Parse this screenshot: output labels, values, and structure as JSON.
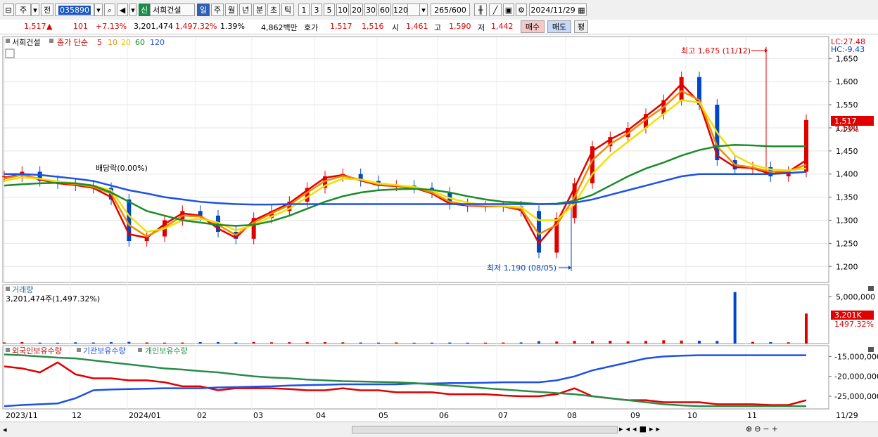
{
  "toolbar": {
    "market": "주",
    "prev": "전",
    "code": "035890",
    "name_tag": "신",
    "name": "서희건설",
    "periods": [
      "일",
      "주",
      "월",
      "년",
      "분",
      "초",
      "틱"
    ],
    "numbers": [
      "1",
      "3",
      "5",
      "10",
      "20",
      "30",
      "60",
      "120"
    ],
    "count": "265",
    "count_total": "/600",
    "date": "2024/11/29"
  },
  "quote": {
    "price": "1,517",
    "arrow": "▲",
    "change": "101",
    "change_pct": "+7.13%",
    "volume": "3,201,474",
    "volume_pct": "1,497.32%",
    "turnover": "1.39%",
    "amount": "4,862백만",
    "hoga_label": "호가",
    "ask": "1,517",
    "bid": "1,516",
    "open_label": "시",
    "open": "1,461",
    "high_label": "고",
    "high": "1,590",
    "low_label": "저",
    "low": "1,442",
    "buy": "매수",
    "sell": "매도",
    "eval": "평"
  },
  "legend": {
    "stock": "서희건설",
    "close_label": "종가 단순",
    "ma": [
      "5",
      "10",
      "20",
      "60",
      "120"
    ],
    "lc": "LC:27.48",
    "hc": "HC:-9.43",
    "dividend": "배당락(0.00%)",
    "high_note": "최고 1,675 (11/12)",
    "low_note": "최저 1,190 (08/05)",
    "last_price": "1,517",
    "last_pct": "7.13%"
  },
  "volume_panel": {
    "title": "거래량",
    "subtitle": "3,201,474주(1,497.32%)",
    "last_box": "3,201K",
    "last_pct": "1497.32%"
  },
  "holdings_panel": {
    "labels": [
      "외국인보유수량",
      "기관보유수량",
      "개인보유수량"
    ]
  },
  "colors": {
    "up": "#e00000",
    "down": "#0046c8",
    "ma5": "#e00000",
    "ma10": "#f08c00",
    "ma20": "#f0e000",
    "ma60": "#1a8c2a",
    "ma120": "#1e50e6",
    "foreign": "#e00000",
    "institution": "#1e50e6",
    "individual": "#2a8c4a"
  },
  "chart_data": [
    {
      "type": "line",
      "title": "서희건설",
      "x": [
        "2023/11",
        "12",
        "2024/01",
        "02",
        "03",
        "04",
        "05",
        "06",
        "07",
        "08",
        "09",
        "10",
        "11",
        "11/29"
      ],
      "ylim": [
        1170,
        1690
      ],
      "yticks": [
        1200,
        1250,
        1300,
        1350,
        1400,
        1450,
        1500,
        1550,
        1600,
        1650
      ],
      "series": [
        {
          "name": "종가",
          "values": [
            1395,
            1405,
            1385,
            1380,
            1375,
            1370,
            1345,
            1255,
            1265,
            1300,
            1320,
            1310,
            1275,
            1260,
            1305,
            1320,
            1340,
            1370,
            1395,
            1400,
            1385,
            1375,
            1375,
            1370,
            1360,
            1335,
            1330,
            1330,
            1330,
            1320,
            1230,
            1305,
            1380,
            1460,
            1480,
            1500,
            1530,
            1560,
            1610,
            1550,
            1430,
            1410,
            1415,
            1395,
            1405,
            1517
          ]
        },
        {
          "name": "5",
          "values": [
            1392,
            1400,
            1388,
            1380,
            1376,
            1370,
            1350,
            1270,
            1262,
            1292,
            1315,
            1310,
            1282,
            1262,
            1300,
            1318,
            1337,
            1365,
            1392,
            1398,
            1386,
            1376,
            1374,
            1370,
            1358,
            1336,
            1332,
            1330,
            1330,
            1322,
            1250,
            1295,
            1370,
            1450,
            1475,
            1495,
            1525,
            1555,
            1595,
            1555,
            1440,
            1415,
            1413,
            1400,
            1405,
            1430
          ]
        },
        {
          "name": "10",
          "values": [
            1390,
            1398,
            1390,
            1382,
            1378,
            1372,
            1358,
            1290,
            1265,
            1285,
            1310,
            1308,
            1290,
            1268,
            1295,
            1315,
            1333,
            1360,
            1385,
            1396,
            1388,
            1378,
            1375,
            1371,
            1360,
            1340,
            1333,
            1331,
            1330,
            1325,
            1270,
            1290,
            1350,
            1430,
            1465,
            1488,
            1518,
            1545,
            1580,
            1560,
            1460,
            1420,
            1414,
            1405,
            1406,
            1420
          ]
        },
        {
          "name": "20",
          "values": [
            1385,
            1393,
            1390,
            1384,
            1380,
            1375,
            1365,
            1310,
            1275,
            1282,
            1300,
            1303,
            1295,
            1278,
            1290,
            1308,
            1325,
            1350,
            1375,
            1390,
            1388,
            1380,
            1376,
            1372,
            1364,
            1348,
            1338,
            1333,
            1331,
            1328,
            1300,
            1300,
            1335,
            1400,
            1440,
            1470,
            1500,
            1530,
            1560,
            1555,
            1490,
            1440,
            1420,
            1410,
            1408,
            1412
          ]
        },
        {
          "name": "60",
          "values": [
            1375,
            1378,
            1380,
            1381,
            1380,
            1375,
            1360,
            1340,
            1320,
            1310,
            1300,
            1295,
            1290,
            1288,
            1290,
            1298,
            1310,
            1325,
            1340,
            1352,
            1360,
            1365,
            1367,
            1368,
            1366,
            1360,
            1352,
            1345,
            1340,
            1338,
            1335,
            1336,
            1342,
            1355,
            1375,
            1395,
            1412,
            1425,
            1440,
            1452,
            1460,
            1463,
            1462,
            1460,
            1460,
            1460
          ]
        },
        {
          "name": "120",
          "values": [
            1400,
            1400,
            1398,
            1394,
            1390,
            1385,
            1375,
            1365,
            1358,
            1350,
            1345,
            1340,
            1337,
            1335,
            1334,
            1334,
            1335,
            1335,
            1335,
            1335,
            1335,
            1335,
            1335,
            1335,
            1335,
            1335,
            1335,
            1335,
            1335,
            1335,
            1335,
            1335,
            1338,
            1345,
            1355,
            1365,
            1375,
            1385,
            1395,
            1400,
            1400,
            1400,
            1400,
            1400,
            1402,
            1405
          ]
        }
      ]
    },
    {
      "type": "bar",
      "title": "거래량",
      "ylim": [
        0,
        6000000
      ],
      "yticks": [
        5000000
      ],
      "series": [
        {
          "name": "거래량",
          "values": [
            120000,
            150000,
            100000,
            90000,
            130000,
            110000,
            140000,
            180000,
            120000,
            100000,
            110000,
            150000,
            160000,
            120000,
            170000,
            130000,
            140000,
            160000,
            150000,
            130000,
            110000,
            100000,
            120000,
            90000,
            100000,
            110000,
            95000,
            100000,
            110000,
            120000,
            250000,
            220000,
            280000,
            260000,
            300000,
            240000,
            280000,
            350000,
            320000,
            300000,
            280000,
            5500000,
            180000,
            150000,
            130000,
            3201474
          ]
        }
      ]
    },
    {
      "type": "line",
      "title": "보유수량",
      "ylim": [
        -28000000,
        -13000000
      ],
      "yticks": [
        -15000000,
        -20000000,
        -25000000
      ],
      "series": [
        {
          "name": "외국인보유수량",
          "values": [
            -17500000,
            -18000000,
            -19000000,
            -16500000,
            -19500000,
            -20500000,
            -20500000,
            -21000000,
            -21000000,
            -21500000,
            -22500000,
            -22500000,
            -23500000,
            -23000000,
            -23000000,
            -23000000,
            -23200000,
            -23500000,
            -23500000,
            -23000000,
            -23500000,
            -23500000,
            -24000000,
            -24000000,
            -24000000,
            -24500000,
            -24500000,
            -24500000,
            -24800000,
            -25000000,
            -25000000,
            -24500000,
            -23000000,
            -25000000,
            -25500000,
            -26000000,
            -26000000,
            -26500000,
            -26500000,
            -26500000,
            -27000000,
            -27000000,
            -27000000,
            -27200000,
            -27200000,
            -26000000
          ]
        },
        {
          "name": "기관보유수량",
          "values": [
            -27500000,
            -27200000,
            -27000000,
            -26800000,
            -25500000,
            -23500000,
            -23300000,
            -23200000,
            -23100000,
            -23000000,
            -23000000,
            -23000000,
            -22800000,
            -22700000,
            -22600000,
            -22500000,
            -22300000,
            -22200000,
            -22100000,
            -22000000,
            -22000000,
            -22000000,
            -22000000,
            -21800000,
            -21800000,
            -21700000,
            -21700000,
            -21600000,
            -21500000,
            -21500000,
            -21500000,
            -21000000,
            -20000000,
            -18500000,
            -17500000,
            -16500000,
            -15500000,
            -15000000,
            -14800000,
            -14700000,
            -14700000,
            -14700000,
            -14700000,
            -14700000,
            -14700000,
            -14700000
          ]
        },
        {
          "name": "개인보유수량",
          "values": [
            -14500000,
            -14700000,
            -15000000,
            -15300000,
            -15500000,
            -16000000,
            -16500000,
            -17000000,
            -17500000,
            -18000000,
            -18300000,
            -18700000,
            -19000000,
            -19500000,
            -20000000,
            -20300000,
            -20500000,
            -20800000,
            -21000000,
            -21200000,
            -21300000,
            -21400000,
            -21500000,
            -21700000,
            -22000000,
            -22300000,
            -22600000,
            -23000000,
            -23300000,
            -23600000,
            -23900000,
            -24200000,
            -24500000,
            -25000000,
            -25500000,
            -26000000,
            -26500000,
            -27000000,
            -27300000,
            -27500000,
            -27500000,
            -27500000,
            -27500000,
            -27500000,
            -27500000,
            -27500000
          ]
        }
      ]
    }
  ]
}
